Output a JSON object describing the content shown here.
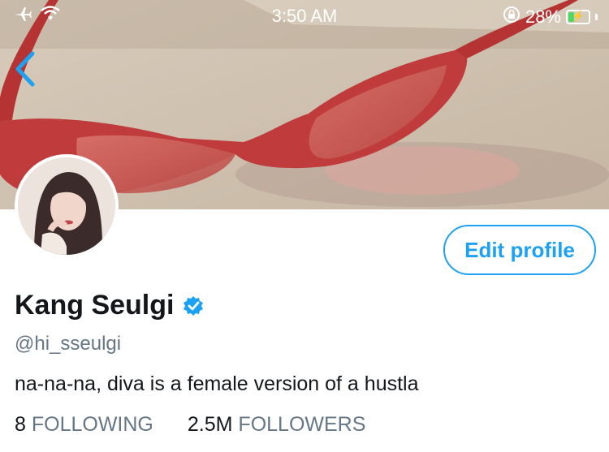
{
  "status_bar": {
    "time": "3:50 AM",
    "battery_percent": "28%",
    "battery_level": 0.28,
    "icons": [
      "airplane-icon",
      "wifi-icon",
      "orientation-lock-icon",
      "battery-icon"
    ]
  },
  "profile": {
    "name": "Kang Seulgi",
    "handle": "@hi_sseulgi",
    "bio": "na-na-na, diva is a female version of a hustla",
    "edit_label": "Edit profile",
    "following_count": "8",
    "following_label": "FOLLOWING",
    "followers_count": "2.5M",
    "followers_label": "FOLLOWERS",
    "verified": true
  },
  "colors": {
    "accent": "#1da1f2",
    "text": "#14171a",
    "secondary": "#657786",
    "battery": "#4cd964"
  }
}
